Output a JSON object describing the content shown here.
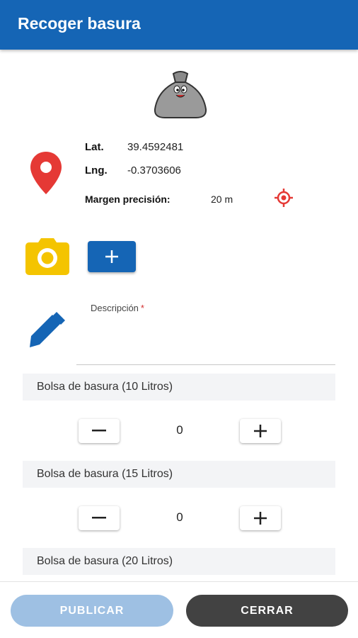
{
  "app_bar": {
    "title": "Recoger basura",
    "color": "#1565b5"
  },
  "location": {
    "lat_label": "Lat.",
    "lat_value": "39.4592481",
    "lng_label": "Lng.",
    "lng_value": "-0.3703606",
    "precision_label": "Margen precisión:",
    "precision_value": "20 m"
  },
  "description": {
    "label": "Descripción",
    "required_marker": "*"
  },
  "bags": [
    {
      "label": "Bolsa de basura (10 Litros)",
      "count": "0"
    },
    {
      "label": "Bolsa de basura (15 Litros)",
      "count": "0"
    },
    {
      "label": "Bolsa de basura (20 Litros)"
    }
  ],
  "footer": {
    "publish_label": "PUBLICAR",
    "close_label": "CERRAR"
  },
  "icons": {
    "bag": "trash-bag-icon",
    "location": "location-pin-icon",
    "gps": "gps-target-icon",
    "camera": "camera-icon",
    "add": "plus-icon",
    "edit": "pencil-icon"
  }
}
